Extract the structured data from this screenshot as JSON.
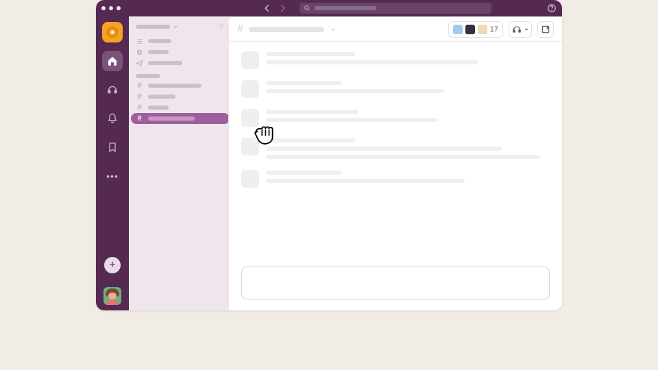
{
  "topbar": {
    "search_placeholder": ""
  },
  "rail": {
    "items": [
      {
        "name": "workspace",
        "icon": "workspace-icon"
      },
      {
        "name": "home",
        "icon": "home-icon"
      },
      {
        "name": "dms",
        "icon": "headset-icon"
      },
      {
        "name": "activity",
        "icon": "bell-icon"
      },
      {
        "name": "bookmarks",
        "icon": "bookmark-icon"
      },
      {
        "name": "more",
        "icon": "more-icon"
      }
    ],
    "add_label": "+"
  },
  "sidebar": {
    "workspace_name": "",
    "nav": [
      {
        "icon": "list",
        "label": ""
      },
      {
        "icon": "at",
        "label": ""
      },
      {
        "icon": "send",
        "label": ""
      }
    ],
    "section_label": "",
    "channels": [
      {
        "prefix": "#",
        "label": "",
        "selected": false
      },
      {
        "prefix": "#",
        "label": "",
        "selected": false
      },
      {
        "prefix": "#",
        "label": "",
        "selected": false
      },
      {
        "prefix": "#",
        "label": "",
        "selected": true
      }
    ]
  },
  "channel": {
    "prefix": "#",
    "name": "",
    "member_count": "17"
  },
  "messages": [
    {
      "lines": [
        130,
        310
      ]
    },
    {
      "lines": [
        110,
        260
      ]
    },
    {
      "lines": [
        135,
        250
      ]
    },
    {
      "lines": [
        130,
        345,
        400
      ]
    },
    {
      "lines": [
        110,
        290
      ]
    }
  ],
  "composer": {
    "placeholder": ""
  }
}
